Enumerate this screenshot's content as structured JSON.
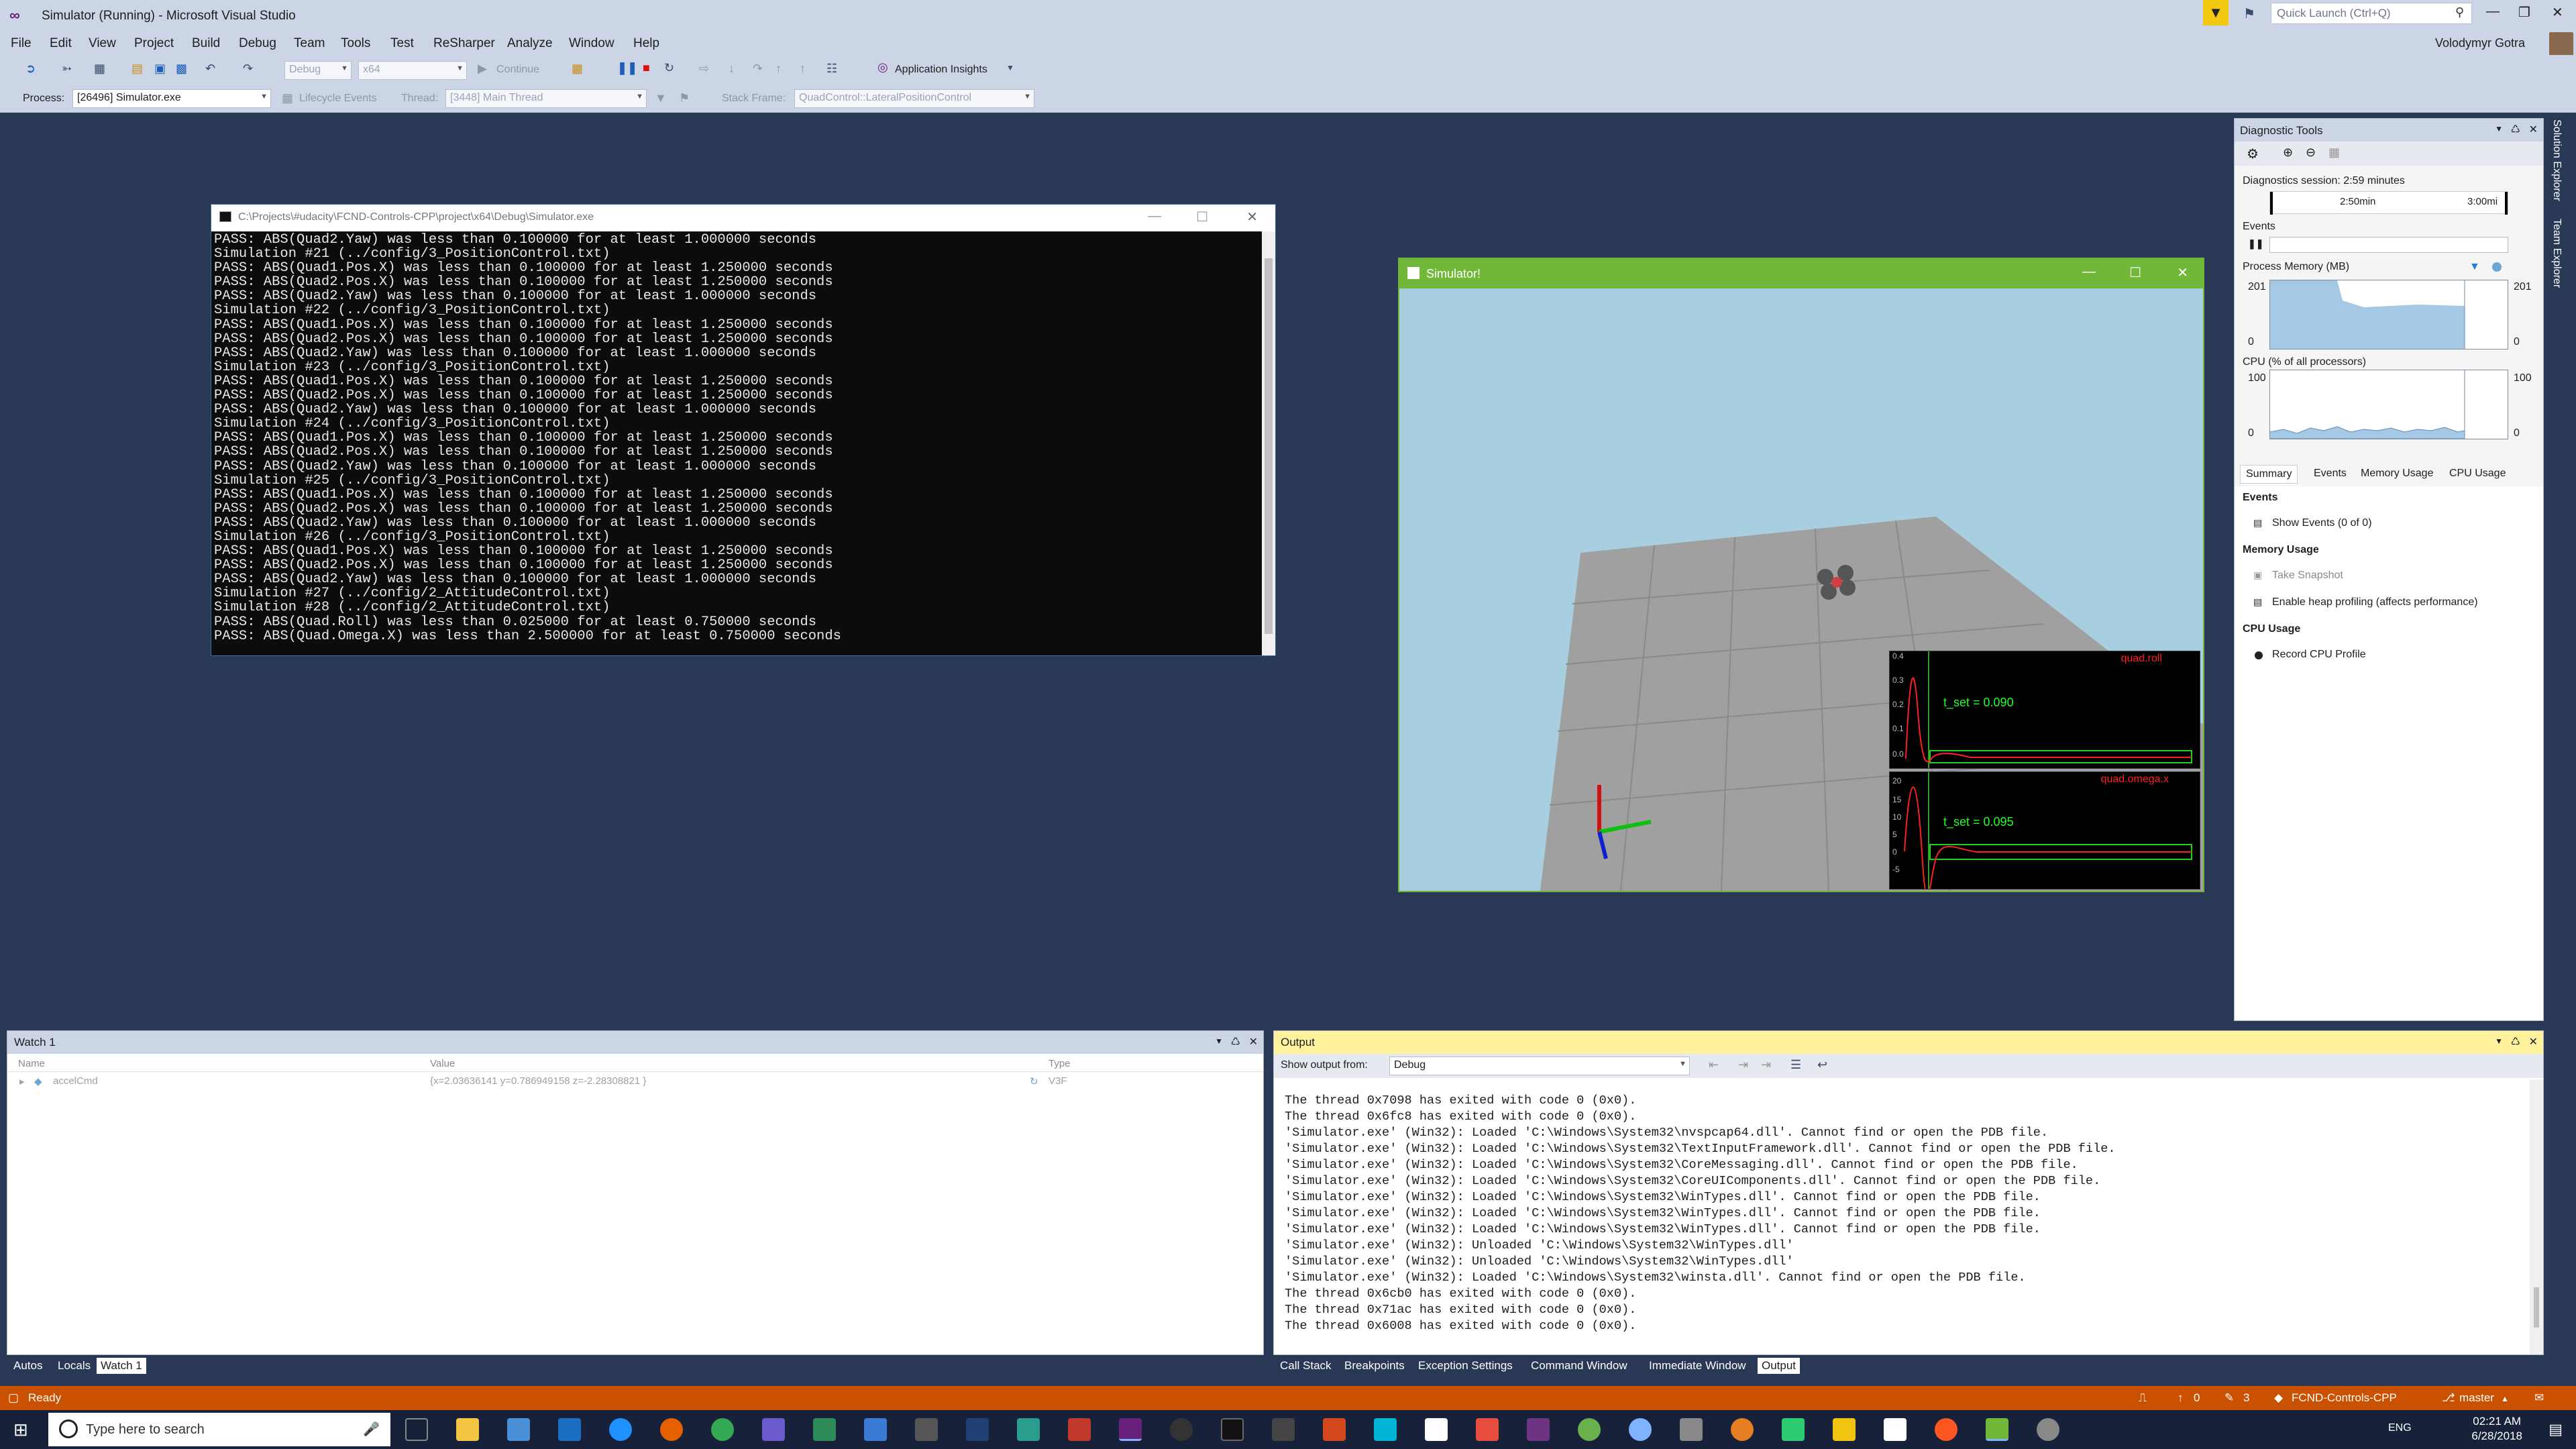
{
  "window": {
    "title": "Simulator (Running) - Microsoft Visual Studio",
    "user": "Volodymyr Gotra",
    "quick_launch_placeholder": "Quick Launch (Ctrl+Q)"
  },
  "menu": [
    "File",
    "Edit",
    "View",
    "Project",
    "Build",
    "Debug",
    "Team",
    "Tools",
    "Test",
    "ReSharper",
    "Analyze",
    "Window",
    "Help"
  ],
  "toolbar": {
    "config": "Debug",
    "platform": "x64",
    "continue_label": "Continue",
    "app_insights": "Application Insights"
  },
  "debug_location": {
    "process_label": "Process:",
    "process": "[26496] Simulator.exe",
    "lifecycle": "Lifecycle Events",
    "thread_label": "Thread:",
    "thread": "[3448] Main Thread",
    "stack_label": "Stack Frame:",
    "stack": "QuadControl::LateralPositionControl"
  },
  "console": {
    "title": "C:\\Projects\\#udacity\\FCND-Controls-CPP\\project\\x64\\Debug\\Simulator.exe",
    "lines": [
      "PASS: ABS(Quad2.Yaw) was less than 0.100000 for at least 1.000000 seconds",
      "Simulation #21 (../config/3_PositionControl.txt)",
      "PASS: ABS(Quad1.Pos.X) was less than 0.100000 for at least 1.250000 seconds",
      "PASS: ABS(Quad2.Pos.X) was less than 0.100000 for at least 1.250000 seconds",
      "PASS: ABS(Quad2.Yaw) was less than 0.100000 for at least 1.000000 seconds",
      "Simulation #22 (../config/3_PositionControl.txt)",
      "PASS: ABS(Quad1.Pos.X) was less than 0.100000 for at least 1.250000 seconds",
      "PASS: ABS(Quad2.Pos.X) was less than 0.100000 for at least 1.250000 seconds",
      "PASS: ABS(Quad2.Yaw) was less than 0.100000 for at least 1.000000 seconds",
      "Simulation #23 (../config/3_PositionControl.txt)",
      "PASS: ABS(Quad1.Pos.X) was less than 0.100000 for at least 1.250000 seconds",
      "PASS: ABS(Quad2.Pos.X) was less than 0.100000 for at least 1.250000 seconds",
      "PASS: ABS(Quad2.Yaw) was less than 0.100000 for at least 1.000000 seconds",
      "Simulation #24 (../config/3_PositionControl.txt)",
      "PASS: ABS(Quad1.Pos.X) was less than 0.100000 for at least 1.250000 seconds",
      "PASS: ABS(Quad2.Pos.X) was less than 0.100000 for at least 1.250000 seconds",
      "PASS: ABS(Quad2.Yaw) was less than 0.100000 for at least 1.000000 seconds",
      "Simulation #25 (../config/3_PositionControl.txt)",
      "PASS: ABS(Quad1.Pos.X) was less than 0.100000 for at least 1.250000 seconds",
      "PASS: ABS(Quad2.Pos.X) was less than 0.100000 for at least 1.250000 seconds",
      "PASS: ABS(Quad2.Yaw) was less than 0.100000 for at least 1.000000 seconds",
      "Simulation #26 (../config/3_PositionControl.txt)",
      "PASS: ABS(Quad1.Pos.X) was less than 0.100000 for at least 1.250000 seconds",
      "PASS: ABS(Quad2.Pos.X) was less than 0.100000 for at least 1.250000 seconds",
      "PASS: ABS(Quad2.Yaw) was less than 0.100000 for at least 1.000000 seconds",
      "Simulation #27 (../config/2_AttitudeControl.txt)",
      "Simulation #28 (../config/2_AttitudeControl.txt)",
      "PASS: ABS(Quad.Roll) was less than 0.025000 for at least 0.750000 seconds",
      "PASS: ABS(Quad.Omega.X) was less than 2.500000 for at least 0.750000 seconds"
    ]
  },
  "simulator": {
    "title": "Simulator!",
    "plot1": {
      "name": "quad.roll",
      "label": "t_set  =  0.090",
      "ticks": [
        "0.4",
        "0.3",
        "0.2",
        "0.1",
        "0.0"
      ]
    },
    "plot2": {
      "name": "quad.omega.x",
      "label": "t_set  =  0.095",
      "ticks": [
        "20",
        "15",
        "10",
        "5",
        "0",
        "-5"
      ]
    }
  },
  "diagnostics": {
    "title": "Diagnostic Tools",
    "session": "Diagnostics session: 2:59 minutes",
    "t1": "2:50min",
    "t2": "3:00mi",
    "events_label": "Events",
    "memory_label": "Process Memory (MB)",
    "mem_max": "201",
    "mem_min": "0",
    "cpu_label": "CPU (% of all processors)",
    "cpu_max": "100",
    "cpu_min": "0",
    "tabs": [
      "Summary",
      "Events",
      "Memory Usage",
      "CPU Usage"
    ],
    "summary": {
      "events_h": "Events",
      "show_events": "Show Events (0 of 0)",
      "memory_h": "Memory Usage",
      "snapshot": "Take Snapshot",
      "heap": "Enable heap profiling (affects performance)",
      "cpu_h": "CPU Usage",
      "record": "Record CPU Profile"
    },
    "side_tabs": [
      "Solution Explorer",
      "Team Explorer"
    ]
  },
  "watch": {
    "title": "Watch 1",
    "cols": [
      "Name",
      "Value",
      "Type"
    ],
    "row": {
      "name": "accelCmd",
      "value": "{x=2.03636141 y=0.786949158 z=-2.28308821 }",
      "type": "V3F"
    },
    "tabs": [
      "Autos",
      "Locals",
      "Watch 1"
    ]
  },
  "output": {
    "title": "Output",
    "show_from": "Show output from:",
    "source": "Debug",
    "lines": [
      "The thread 0x7098 has exited with code 0 (0x0).",
      "The thread 0x6fc8 has exited with code 0 (0x0).",
      "'Simulator.exe' (Win32): Loaded 'C:\\Windows\\System32\\nvspcap64.dll'. Cannot find or open the PDB file.",
      "'Simulator.exe' (Win32): Loaded 'C:\\Windows\\System32\\TextInputFramework.dll'. Cannot find or open the PDB file.",
      "'Simulator.exe' (Win32): Loaded 'C:\\Windows\\System32\\CoreMessaging.dll'. Cannot find or open the PDB file.",
      "'Simulator.exe' (Win32): Loaded 'C:\\Windows\\System32\\CoreUIComponents.dll'. Cannot find or open the PDB file.",
      "'Simulator.exe' (Win32): Loaded 'C:\\Windows\\System32\\WinTypes.dll'. Cannot find or open the PDB file.",
      "'Simulator.exe' (Win32): Loaded 'C:\\Windows\\System32\\WinTypes.dll'. Cannot find or open the PDB file.",
      "'Simulator.exe' (Win32): Loaded 'C:\\Windows\\System32\\WinTypes.dll'. Cannot find or open the PDB file.",
      "'Simulator.exe' (Win32): Unloaded 'C:\\Windows\\System32\\WinTypes.dll'",
      "'Simulator.exe' (Win32): Unloaded 'C:\\Windows\\System32\\WinTypes.dll'",
      "'Simulator.exe' (Win32): Loaded 'C:\\Windows\\System32\\winsta.dll'. Cannot find or open the PDB file.",
      "The thread 0x6cb0 has exited with code 0 (0x0).",
      "The thread 0x71ac has exited with code 0 (0x0).",
      "The thread 0x6008 has exited with code 0 (0x0)."
    ],
    "tabs": [
      "Call Stack",
      "Breakpoints",
      "Exception Settings",
      "Command Window",
      "Immediate Window",
      "Output"
    ]
  },
  "status": {
    "ready": "Ready",
    "up": "0",
    "pencil": "3",
    "repo": "FCND-Controls-CPP",
    "branch": "master"
  },
  "taskbar": {
    "search": "Type here to search",
    "lang": "ENG",
    "time": "02:21 AM",
    "date": "6/28/2018"
  }
}
